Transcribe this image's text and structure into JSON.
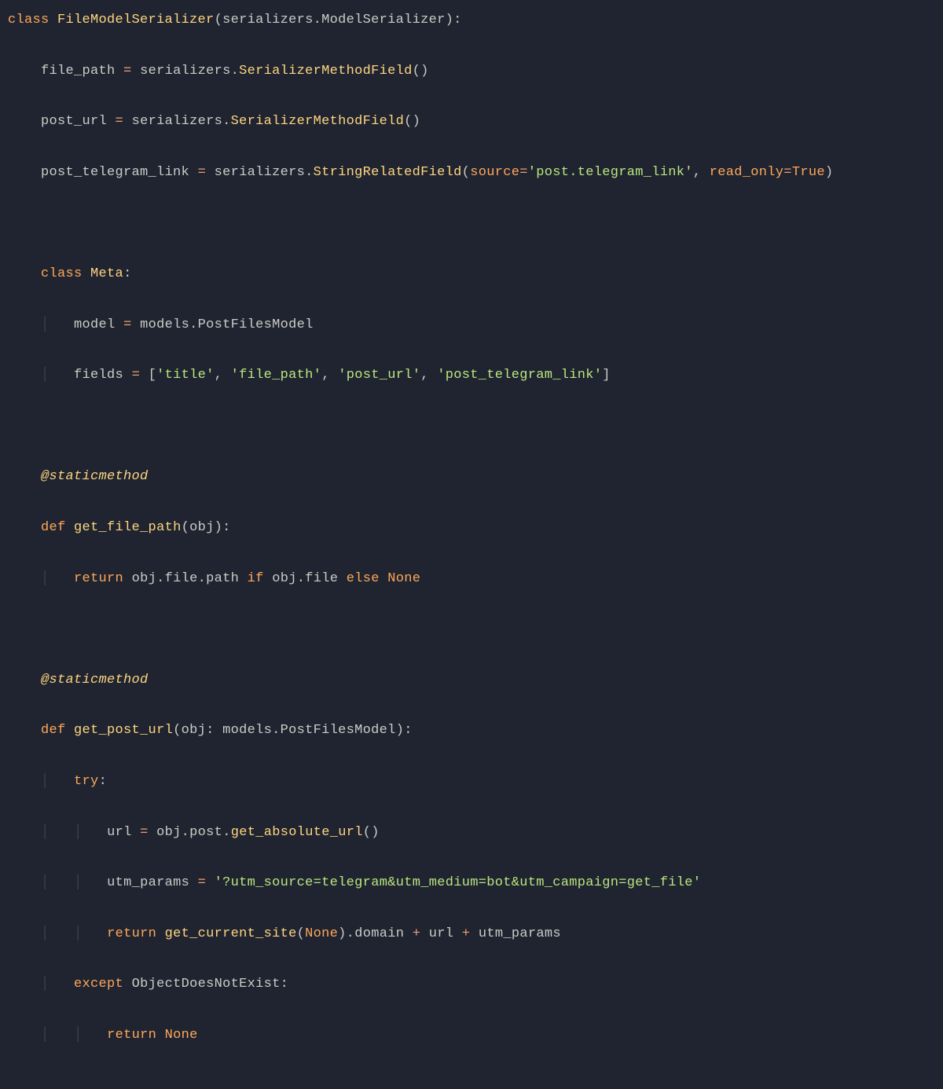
{
  "code": {
    "class_keyword": "class",
    "class_name": "FileModelSerializer",
    "base1": "serializers",
    "base2": "ModelSerializer",
    "field1_name": "file_path",
    "field1_call_a": "serializers",
    "field1_call_b": "SerializerMethodField",
    "field2_name": "post_url",
    "field2_call_a": "serializers",
    "field2_call_b": "SerializerMethodField",
    "field3_name": "post_telegram_link",
    "field3_call_a": "serializers",
    "field3_call_b": "StringRelatedField",
    "field3_kw1": "source",
    "field3_kw1_val": "'post.telegram_link'",
    "field3_kw2": "read_only",
    "field3_kw2_val": "True",
    "meta_class_kw": "class",
    "meta_name": "Meta",
    "meta_model_name": "model",
    "meta_model_val_a": "models",
    "meta_model_val_b": "PostFilesModel",
    "meta_fields_name": "fields",
    "meta_fields_list0": "'title'",
    "meta_fields_list1": "'file_path'",
    "meta_fields_list2": "'post_url'",
    "meta_fields_list3": "'post_telegram_link'",
    "decorator1": "@staticmethod",
    "def_kw": "def",
    "m1_name": "get_file_path",
    "m1_param": "obj",
    "return_kw": "return",
    "m1_ret_a": "obj",
    "m1_ret_b": "file",
    "m1_ret_c": "path",
    "if_kw": "if",
    "m1_if_a": "obj",
    "m1_if_b": "file",
    "else_kw": "else",
    "none_kw": "None",
    "decorator2": "@staticmethod",
    "m2_name": "get_post_url",
    "m2_param": "obj",
    "m2_anno_a": "models",
    "m2_anno_b": "PostFilesModel",
    "try_kw": "try",
    "m2_url_var": "url",
    "m2_url_a": "obj",
    "m2_url_b": "post",
    "m2_url_c": "get_absolute_url",
    "m2_utm_var": "utm_params",
    "m2_utm_val": "'?utm_source=telegram&utm_medium=bot&utm_campaign=get_file'",
    "m2_ret_fn": "get_current_site",
    "m2_ret_arg": "None",
    "m2_ret_attr": "domain",
    "m2_ret_plus1": "url",
    "m2_ret_plus2": "utm_params",
    "except_kw": "except",
    "except_cls": "ObjectDoesNotExist"
  }
}
